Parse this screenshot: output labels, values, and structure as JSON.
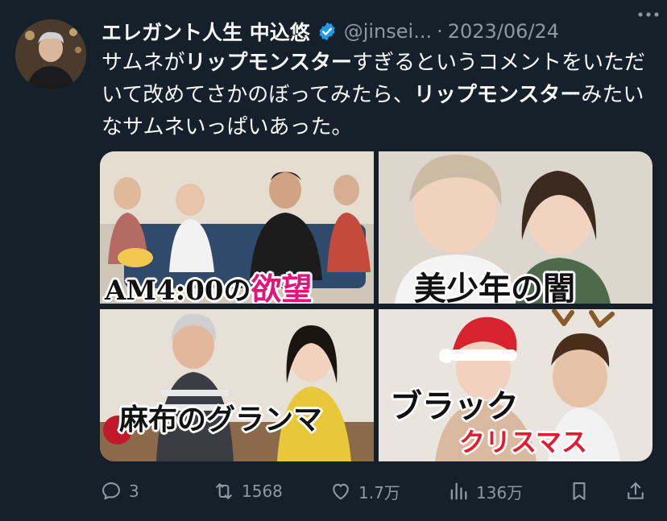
{
  "author": {
    "name": "エレガント人生 中込悠",
    "handle": "@jinsei...",
    "date": "2023/06/24",
    "separator": "·"
  },
  "tweet": {
    "seg1": "サムネが",
    "seg2": "リップモンスター",
    "seg3": "すぎるというコメントをいただいて改めてさかのぼってみたら、",
    "seg4": "リップモンスター",
    "seg5": "みたいなサムネいっぱいあった。"
  },
  "media": {
    "thumbs": [
      {
        "caption_main": "AM4:00の",
        "caption_accent": "欲望",
        "accent_color": "#e0147a"
      },
      {
        "caption_main": "美少年の闇"
      },
      {
        "caption_main": "麻布のグランマ"
      },
      {
        "caption_main": "ブラック",
        "caption_accent": "クリスマス",
        "accent_color": "#e8192c"
      }
    ]
  },
  "actions": {
    "reply_count": "3",
    "retweet_count": "1568",
    "like_count": "1.7万",
    "views_count": "136万"
  },
  "colors": {
    "background": "#15202b",
    "text": "#f7f9f9",
    "muted": "#8b98a5",
    "verified": "#1d9bf0"
  },
  "icons": [
    "verified-badge-icon",
    "more-icon",
    "reply-icon",
    "retweet-icon",
    "like-icon",
    "views-icon",
    "bookmark-icon",
    "share-icon"
  ]
}
